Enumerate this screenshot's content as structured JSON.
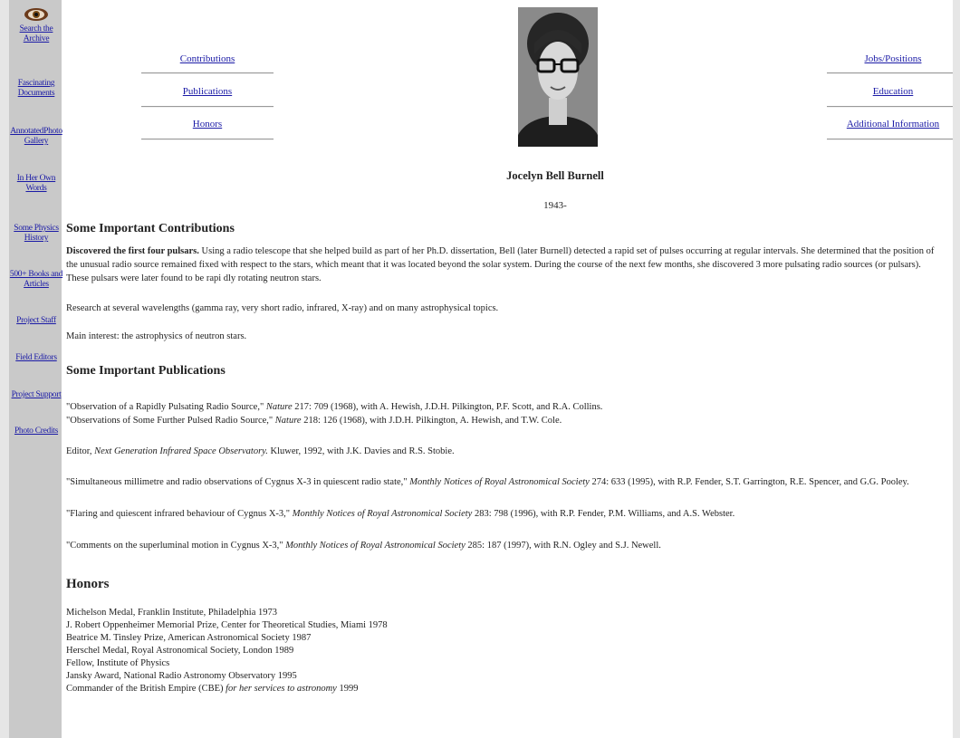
{
  "sidebar": {
    "items": [
      {
        "line1": "Search the",
        "line2": "Archive"
      },
      {
        "line1": "Fascinating",
        "line2": "Documents"
      },
      {
        "line1": "AnnotatedPhoto",
        "line2": "Gallery"
      },
      {
        "line1": "In Her Own",
        "line2": "Words"
      },
      {
        "line1": "Some Physics",
        "line2": "History"
      },
      {
        "line1": "500+ Books and",
        "line2": "Articles"
      },
      {
        "line1": "Project Staff",
        "line2": ""
      },
      {
        "line1": "Field Editors",
        "line2": ""
      },
      {
        "line1": "Project Support",
        "line2": ""
      },
      {
        "line1": "Photo Credits",
        "line2": ""
      }
    ]
  },
  "topnav": {
    "left": [
      "Contributions",
      "Publications",
      "Honors"
    ],
    "right": [
      "Jobs/Positions",
      "Education",
      "Additional Information"
    ]
  },
  "person": {
    "name": "Jocelyn Bell Burnell",
    "years": "1943-"
  },
  "contributions": {
    "heading": "Some Important Contributions",
    "lead_bold": "Discovered the first four pulsars.",
    "lead_text": " Using a radio telescope that she helped build as part of her Ph.D. dissertation, Bell (later Burnell) detected a rapid set of pulses occurring at regular intervals. She determined that the position of the unusual radio source remained fixed with respect to the stars, which meant that it was located beyond the solar system. During the course of the next few months, she discovered 3 more pulsating radio sources (or pulsars). These pulsars were later found to be rapi dly rotating neutron stars.",
    "p2": "Research at several wavelengths (gamma ray, very short radio, infrared, X-ray) and on many astrophysical topics.",
    "p3": "Main interest: the astrophysics of neutron stars."
  },
  "publications": {
    "heading": "Some Important Publications",
    "items": [
      {
        "pre": "\"Observation of a Rapidly Pulsating Radio Source,\" ",
        "journal": "Nature",
        "post": " 217: 709 (1968), with A. Hewish, J.D.H. Pilkington, P.F. Scott, and R.A. Collins."
      },
      {
        "pre": "\"Observations of Some Further Pulsed Radio Source,\" ",
        "journal": "Nature",
        "post": " 218: 126 (1968), with J.D.H. Pilkington, A. Hewish, and T.W. Cole."
      },
      {
        "pre": "Editor, ",
        "journal": "Next Generation Infrared Space Observatory.",
        "post": " Kluwer, 1992, with J.K. Davies and R.S. Stobie."
      },
      {
        "pre": "\"Simultaneous millimetre and radio observations of Cygnus X-3 in quiescent radio state,\" ",
        "journal": "Monthly Notices of Royal Astronomical Society",
        "post": " 274: 633 (1995), with R.P. Fender, S.T. Garrington, R.E. Spencer, and G.G. Pooley."
      },
      {
        "pre": "\"Flaring and quiescent infrared behaviour of Cygnus X-3,\" ",
        "journal": "Monthly Notices of Royal Astronomical Society",
        "post": " 283: 798 (1996), with R.P. Fender, P.M. Williams, and A.S. Webster."
      },
      {
        "pre": "\"Comments on the superluminal motion in Cygnus X-3,\" ",
        "journal": "Monthly Notices of Royal Astronomical Society",
        "post": " 285: 187 (1997), with R.N. Ogley and S.J. Newell."
      }
    ]
  },
  "honors": {
    "heading": "Honors",
    "items": [
      {
        "text": "Michelson Medal, Franklin Institute, Philadelphia 1973",
        "italic": "",
        "tail": ""
      },
      {
        "text": "J. Robert Oppenheimer Memorial Prize, Center for Theoretical Studies, Miami 1978",
        "italic": "",
        "tail": ""
      },
      {
        "text": "Beatrice M. Tinsley Prize, American Astronomical Society 1987",
        "italic": "",
        "tail": ""
      },
      {
        "text": "Herschel Medal, Royal Astronomical Society, London 1989",
        "italic": "",
        "tail": ""
      },
      {
        "text": "Fellow, Institute of Physics",
        "italic": "",
        "tail": ""
      },
      {
        "text": "Jansky Award, National Radio Astronomy Observatory 1995",
        "italic": "",
        "tail": ""
      },
      {
        "text": "Commander of the British Empire (CBE) ",
        "italic": "for her services to astronomy",
        "tail": " 1999"
      }
    ]
  }
}
